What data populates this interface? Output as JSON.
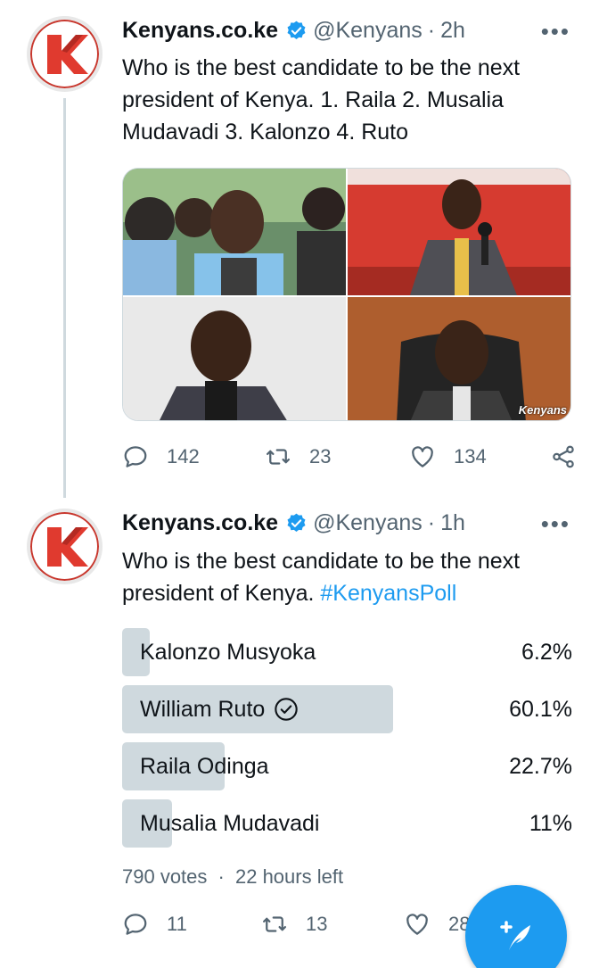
{
  "tweets": [
    {
      "name": "Kenyans.co.ke",
      "handle": "@Kenyans",
      "time": "2h",
      "text": "Who is the best candidate to be the next president of Kenya. 1. Raila 2. Musalia Mudavadi 3. Kalonzo 4. Ruto",
      "media_watermark": "Kenyans",
      "replies": "142",
      "retweets": "23",
      "likes": "134"
    },
    {
      "name": "Kenyans.co.ke",
      "handle": "@Kenyans",
      "time": "1h",
      "text": "Who is the best candidate to be the next president of Kenya.",
      "hashtag": "#KenyansPoll",
      "poll": {
        "options": [
          {
            "label": "Kalonzo Musyoka",
            "percent": "6.2%",
            "fraction": 0.062
          },
          {
            "label": "William Ruto",
            "percent": "60.1%",
            "fraction": 0.601,
            "selected": true
          },
          {
            "label": "Raila Odinga",
            "percent": "22.7%",
            "fraction": 0.227
          },
          {
            "label": "Musalia Mudavadi",
            "percent": "11%",
            "fraction": 0.11
          }
        ],
        "votes": "790 votes",
        "time_left": "22 hours left"
      },
      "replies": "11",
      "retweets": "13",
      "likes": "28"
    }
  ],
  "more_glyph": "•••",
  "dot": "·",
  "icons": {
    "verified": "verified-badge-icon",
    "reply": "reply-icon",
    "retweet": "retweet-icon",
    "like": "heart-icon",
    "share": "share-icon",
    "compose": "compose-tweet-icon"
  },
  "colors": {
    "accent": "#1d9bf0",
    "poll_bar": "#cfd9de",
    "secondary_text": "#536471",
    "logo_red": "#c8372d"
  }
}
